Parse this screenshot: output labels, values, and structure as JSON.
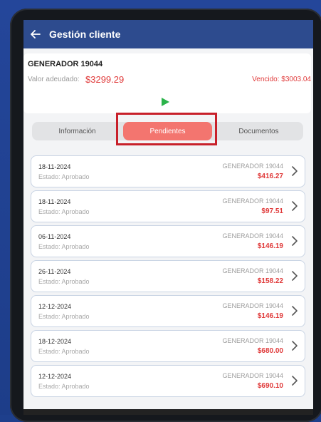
{
  "header": {
    "back_icon": "arrow-left-icon",
    "title": "Gestión cliente"
  },
  "client": {
    "name": "GENERADOR 19044",
    "owed_label": "Valor adeudado:",
    "owed_value": "$3299.29",
    "overdue": "Vencido: $3003.04",
    "play_icon": "play-icon"
  },
  "tabs": [
    {
      "label": "Información",
      "active": false
    },
    {
      "label": "Pendientes",
      "active": true
    },
    {
      "label": "Documentos",
      "active": false
    }
  ],
  "items": [
    {
      "date": "18-11-2024",
      "status": "Estado: Aprobado",
      "client": "GENERADOR 19044",
      "amount": "$416.27"
    },
    {
      "date": "18-11-2024",
      "status": "Estado: Aprobado",
      "client": "GENERADOR 19044",
      "amount": "$97.51"
    },
    {
      "date": "06-11-2024",
      "status": "Estado: Aprobado",
      "client": "GENERADOR 19044",
      "amount": "$146.19"
    },
    {
      "date": "26-11-2024",
      "status": "Estado: Aprobado",
      "client": "GENERADOR 19044",
      "amount": "$158.22"
    },
    {
      "date": "12-12-2024",
      "status": "Estado: Aprobado",
      "client": "GENERADOR 19044",
      "amount": "$146.19"
    },
    {
      "date": "18-12-2024",
      "status": "Estado: Aprobado",
      "client": "GENERADOR 19044",
      "amount": "$680.00"
    },
    {
      "date": "12-12-2024",
      "status": "Estado: Aprobado",
      "client": "GENERADOR 19044",
      "amount": "$690.10"
    }
  ],
  "colors": {
    "appbar": "#2d4b8e",
    "accent_tab": "#f3756f",
    "amount_red": "#e03b3b",
    "highlight": "#c8202a",
    "play_green": "#2bb34a"
  }
}
